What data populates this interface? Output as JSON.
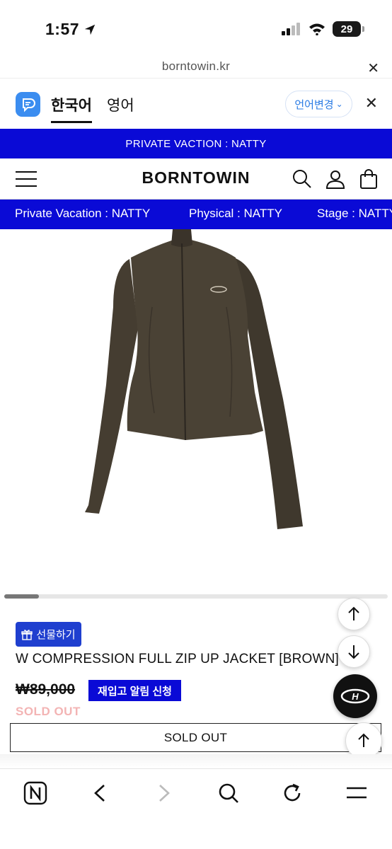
{
  "status_bar": {
    "time": "1:57",
    "battery": "29"
  },
  "url_bar": {
    "url": "borntowin.kr"
  },
  "translate_bar": {
    "tabs": [
      "한국어",
      "영어"
    ],
    "change_language_label": "언어변경"
  },
  "promo_banner": {
    "text": "PRIVATE VACTION : NATTY"
  },
  "header": {
    "brand": "BORNTOWIN"
  },
  "marquee": {
    "items": [
      "Private Vacation : NATTY",
      "Physical : NATTY",
      "Stage : NATTY"
    ]
  },
  "product": {
    "gift_label": "선물하기",
    "name": "W COMPRESSION FULL ZIP UP JACKET [BROWN]",
    "price": "₩89,000",
    "restock_label": "재입고 알림 신청",
    "sold_out_status": "SOLD OUT",
    "sold_out_button": "SOLD OUT"
  },
  "colors": {
    "brand_blue": "#0a0ad6",
    "jacket_brown": "#4a4235"
  },
  "icons": {
    "header": [
      "menu-icon",
      "search-icon",
      "user-icon",
      "cart-icon"
    ],
    "toolbar": [
      "n-browser-icon",
      "back-icon",
      "forward-icon",
      "search-icon",
      "refresh-icon",
      "menu-icon"
    ]
  }
}
